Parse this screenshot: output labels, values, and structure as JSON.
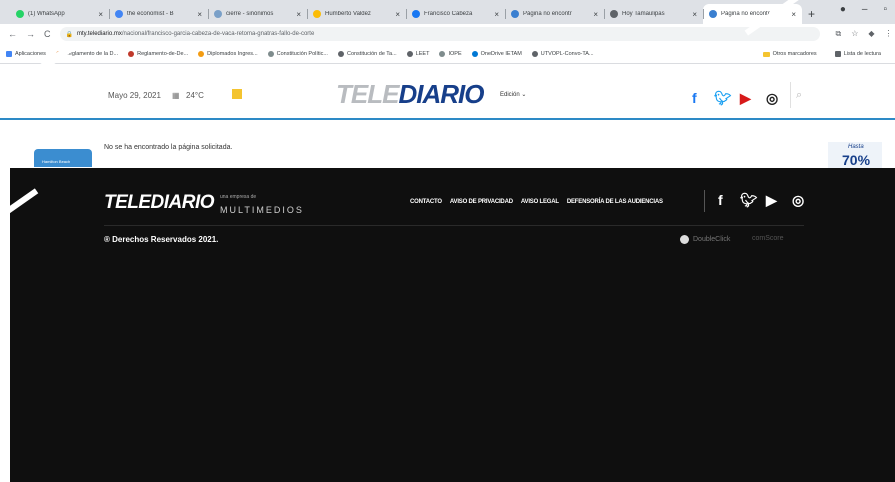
{
  "browser": {
    "tabs": [
      {
        "title": "(1) WhatsApp",
        "color": "#25d366"
      },
      {
        "title": "the economist - B",
        "color": "#4285f4"
      },
      {
        "title": "cierre - sinónimos",
        "color": "#7aa0c8"
      },
      {
        "title": "Humberto Valdez",
        "color": "#fbbc05"
      },
      {
        "title": "Francisco Cabeza",
        "color": "#1877f2"
      },
      {
        "title": "Página no encontr",
        "color": "#3a7fd0"
      },
      {
        "title": "Hoy Tamaulipas",
        "color": "#5f6368"
      },
      {
        "title": "Página no encontr",
        "color": "#3a7fd0"
      }
    ],
    "url_host": "mty.telediario.mx",
    "url_path": "/nacional/francisco-garcia-cabeza-de-vaca-retoma-gnatras-fallo-de-corte",
    "bookmarks": [
      "Aplicaciones",
      "Reglamento de la D...",
      "Reglamento-de-De...",
      "Diplomados Ingres...",
      "Constitución Polític...",
      "Constitución de Ta...",
      "LEET",
      "IOPE",
      "OneDrive IETAM",
      "UTVOPL-Convo-TA..."
    ],
    "bookmarks_right": [
      "Otros marcadores",
      "Lista de lectura"
    ]
  },
  "header": {
    "date": "Mayo 29, 2021",
    "temperature": "24°C",
    "logo_tele": "TELE",
    "logo_d": "D",
    "logo_iario": "IARIO",
    "edition": "Edición"
  },
  "content": {
    "not_found": "No se ha encontrado la página solicitada.",
    "ad_left_text": "Hamilton Beach",
    "ad_right_hasta": "Hasta",
    "ad_right_pct": "70%"
  },
  "footer": {
    "logo": "TELEDIARIO",
    "tagline": "una empresa de",
    "multimedios": "MULTIMEDIOS",
    "nav": [
      "CONTACTO",
      "AVISO DE PRIVACIDAD",
      "AVISO LEGAL",
      "DEFENSORÍA DE LAS AUDIENCIAS"
    ],
    "copyright": "® Derechos Reservados 2021.",
    "doubleclick": "DoubleClick",
    "comscore": "comScore"
  }
}
